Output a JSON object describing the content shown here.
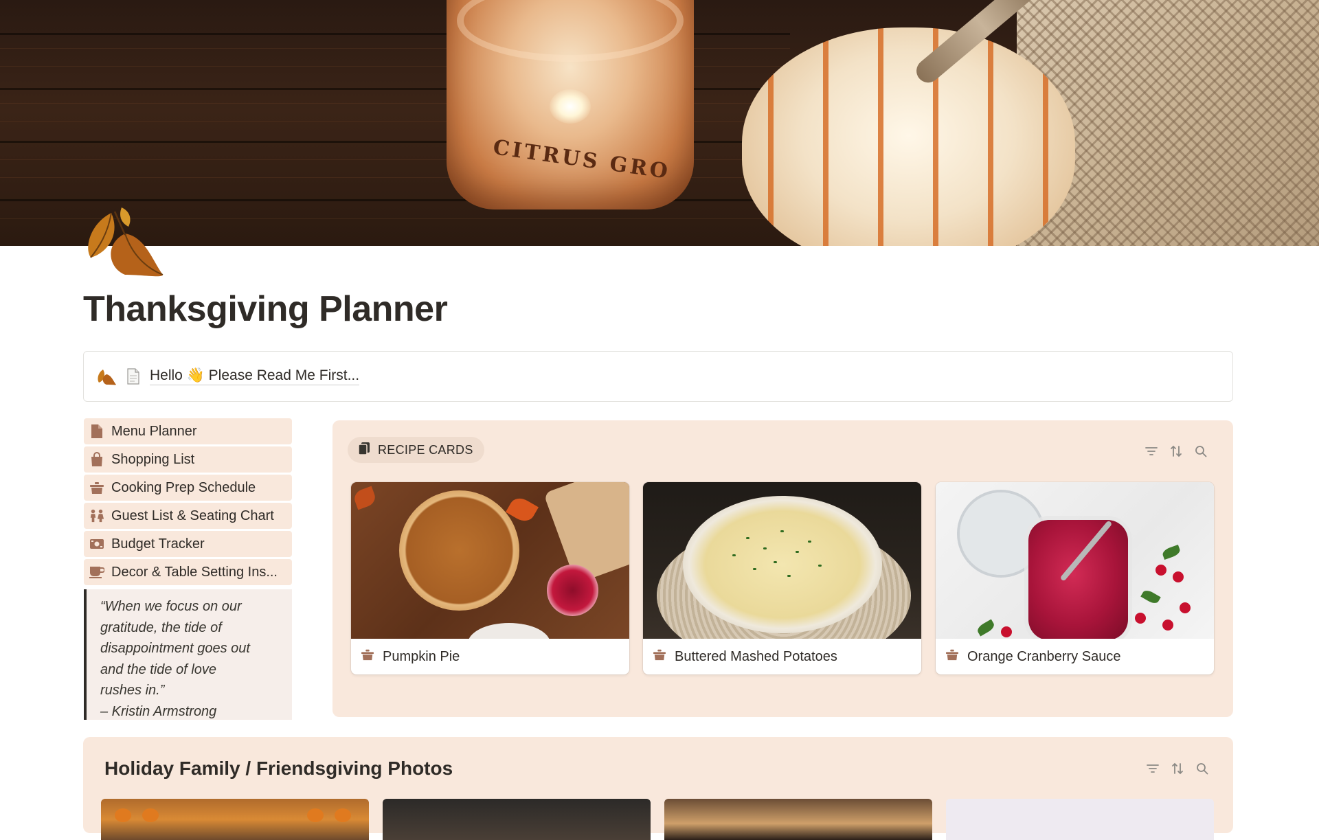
{
  "page": {
    "title": "Thanksgiving Planner",
    "icon": "autumn-leaves-icon",
    "cover": "candle-and-pumpkin-cover"
  },
  "callout": {
    "link_text": "Hello 👋 Please Read Me First...",
    "icons": [
      "autumn-leaves-icon",
      "document-icon"
    ]
  },
  "nav": {
    "items": [
      {
        "label": "Menu Planner",
        "icon": "document-icon"
      },
      {
        "label": "Shopping List",
        "icon": "shopping-bag-icon"
      },
      {
        "label": "Cooking Prep Schedule",
        "icon": "cooking-pot-icon"
      },
      {
        "label": "Guest List & Seating Chart",
        "icon": "people-icon"
      },
      {
        "label": "Budget Tracker",
        "icon": "money-icon"
      },
      {
        "label": "Decor & Table Setting Ins...",
        "icon": "coffee-cup-icon"
      }
    ]
  },
  "quote": {
    "lines": [
      "“When we focus on our",
      "gratitude, the tide of",
      "disappointment goes out",
      "and the tide of love",
      "rushes in.”",
      "– Kristin Armstrong"
    ]
  },
  "recipes": {
    "tab_label": "RECIPE CARDS",
    "tab_icon": "cards-icon",
    "cards": [
      {
        "title": "Pumpkin Pie",
        "icon": "cooking-pot-icon"
      },
      {
        "title": "Buttered Mashed Potatoes",
        "icon": "cooking-pot-icon"
      },
      {
        "title": "Orange Cranberry Sauce",
        "icon": "cooking-pot-icon"
      }
    ]
  },
  "photos": {
    "title": "Holiday Family / Friendsgiving Photos"
  },
  "toolbar": {
    "icons": [
      "filter-icon",
      "sort-icon",
      "search-icon"
    ]
  },
  "colors": {
    "accent_background": "#f9e8dc",
    "tab_background": "#efdcce",
    "quote_background": "#f6eeea",
    "text": "#2f2b27",
    "icon_brown": "#a2705a"
  }
}
